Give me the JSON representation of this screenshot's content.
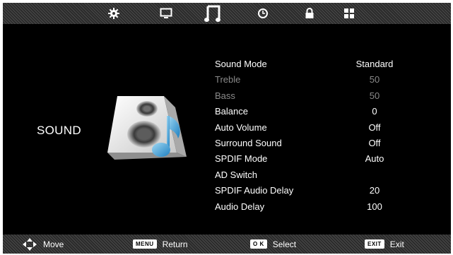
{
  "tabs": [
    {
      "icon": "gear-icon"
    },
    {
      "icon": "monitor-icon"
    },
    {
      "icon": "music-note-icon",
      "active": true
    },
    {
      "icon": "clock-icon"
    },
    {
      "icon": "lock-icon"
    },
    {
      "icon": "grid-icon"
    }
  ],
  "section_title": "SOUND",
  "menu": [
    {
      "label": "Sound Mode",
      "value": "Standard",
      "dim": false
    },
    {
      "label": "Treble",
      "value": "50",
      "dim": true
    },
    {
      "label": "Bass",
      "value": "50",
      "dim": true
    },
    {
      "label": "Balance",
      "value": "0",
      "dim": false
    },
    {
      "label": "Auto Volume",
      "value": "Off",
      "dim": false
    },
    {
      "label": "Surround Sound",
      "value": "Off",
      "dim": false
    },
    {
      "label": "SPDIF Mode",
      "value": "Auto",
      "dim": false
    },
    {
      "label": "AD Switch",
      "value": "",
      "dim": false
    },
    {
      "label": "SPDIF Audio Delay",
      "value": "20",
      "dim": false
    },
    {
      "label": "Audio Delay",
      "value": "100",
      "dim": false
    }
  ],
  "hints": {
    "move": {
      "label": "Move"
    },
    "return": {
      "key": "MENU",
      "label": "Return"
    },
    "select": {
      "key": "O K",
      "label": "Select"
    },
    "exit": {
      "key": "EXIT",
      "label": "Exit"
    }
  },
  "colors": {
    "accent": "#3fa8dc",
    "background": "#000000",
    "dim_text": "#8a8a8a"
  }
}
